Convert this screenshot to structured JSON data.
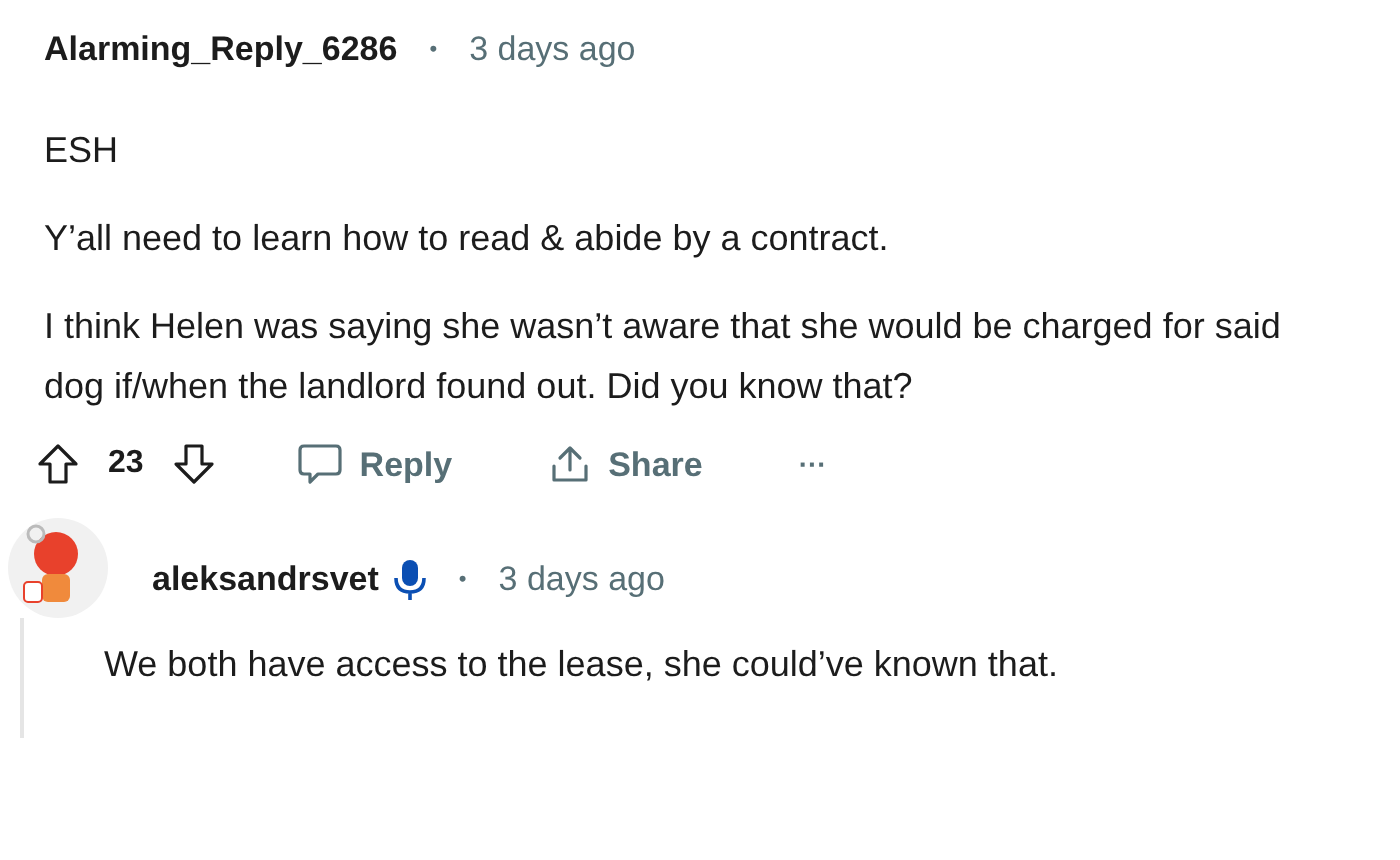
{
  "comment": {
    "author": "Alarming_Reply_6286",
    "separator": "•",
    "time": "3 days ago",
    "paragraphs": [
      "ESH",
      "Y’all need to learn how to read & abide by a contract.",
      "I think Helen was saying she wasn’t aware that she would be charged for said dog if/when the landlord found out. Did you know that?"
    ],
    "actions": {
      "score": "23",
      "reply": "Reply",
      "share": "Share",
      "more": "···"
    }
  },
  "reply": {
    "author": "aleksandrsvet",
    "voice_badge": true,
    "separator": "•",
    "time": "3 days ago",
    "body": "We both have access to the lease, she could’ve known that."
  }
}
